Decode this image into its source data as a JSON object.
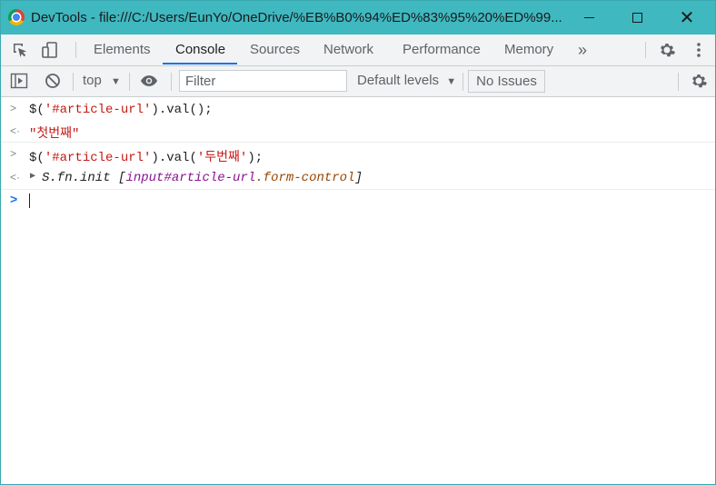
{
  "window": {
    "title": "DevTools - file:///C:/Users/EunYo/OneDrive/%EB%B0%94%ED%83%95%20%ED%99...",
    "minimize_glyph": "—",
    "maximize_glyph": "☐",
    "close_glyph": "✕"
  },
  "tabs": {
    "items": [
      "Elements",
      "Console",
      "Sources",
      "Network",
      "Performance",
      "Memory"
    ],
    "active": "Console",
    "more_glyph": "»"
  },
  "toolbar": {
    "context": "top",
    "filter_placeholder": "Filter",
    "levels": "Default levels",
    "issues": "No Issues"
  },
  "console": {
    "entries": [
      {
        "kind": "input",
        "prefix": "$(",
        "arg": "'#article-url'",
        "suffix": ").val();"
      },
      {
        "kind": "result",
        "value": "\"첫번째\""
      },
      {
        "kind": "input",
        "prefix": "$(",
        "arg": "'#article-url'",
        "mid": ").val(",
        "arg2": "'두번째'",
        "suffix": ");"
      },
      {
        "kind": "result",
        "text": "S.fn.init",
        "bracket_open": "[",
        "element_tag": "input#article-url",
        "element_class": ".form-control",
        "bracket_close": "]"
      }
    ]
  },
  "colors": {
    "titlebar": "#3fb8c0",
    "accent": "#1a73e8",
    "string": "#c41a16",
    "element": "#881391"
  }
}
